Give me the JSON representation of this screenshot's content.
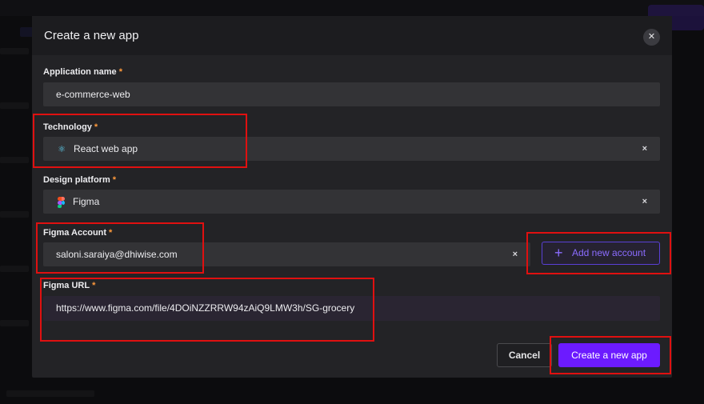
{
  "modal": {
    "title": "Create a new app",
    "close_icon": "close-icon"
  },
  "fields": {
    "app_name": {
      "label": "Application name",
      "required": "*",
      "value": "e-commerce-web"
    },
    "technology": {
      "label": "Technology",
      "required": "*",
      "value": "React web app",
      "icon": "react-icon",
      "clear": "×"
    },
    "design_platform": {
      "label": "Design platform",
      "required": "*",
      "value": "Figma",
      "icon": "figma-icon",
      "clear": "×"
    },
    "figma_account": {
      "label": "Figma Account",
      "required": "*",
      "value": "saloni.saraiya@dhiwise.com",
      "clear": "×"
    },
    "figma_url": {
      "label": "Figma URL",
      "required": "*",
      "value": "https://www.figma.com/file/4DOiNZZRRW94zAiQ9LMW3h/SG-grocery"
    }
  },
  "buttons": {
    "add_account": "Add new account",
    "add_plus": "+",
    "cancel": "Cancel",
    "create": "Create a new app"
  },
  "colors": {
    "accent": "#6c1bff",
    "highlight": "#e01010",
    "required": "#ff9a3c"
  }
}
